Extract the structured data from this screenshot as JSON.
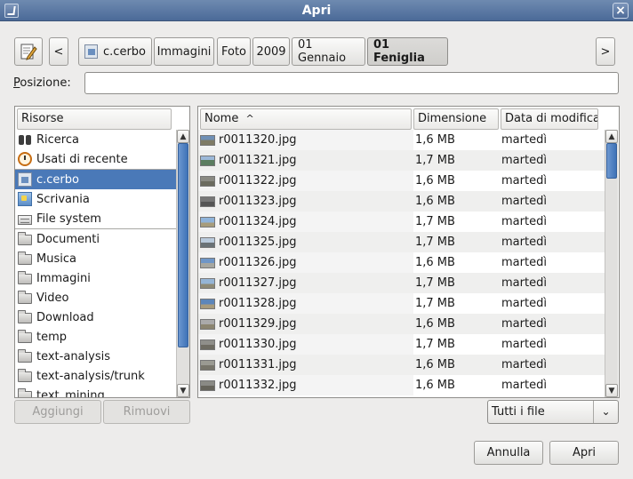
{
  "window": {
    "title": "Apri"
  },
  "breadcrumb": {
    "back": "<",
    "forward": ">",
    "items": [
      "c.cerbo",
      "Immagini",
      "Foto",
      "2009",
      "01 Gennaio",
      "01 Feniglia"
    ],
    "active_index": 5
  },
  "location": {
    "label": "Posizione:",
    "value": ""
  },
  "places": {
    "header": "Risorse",
    "items": [
      {
        "label": "Ricerca",
        "icon": "binoculars-icon"
      },
      {
        "label": "Usati di recente",
        "icon": "recent-clock-icon"
      },
      {
        "label": "c.cerbo",
        "icon": "home-folder-icon"
      },
      {
        "label": "Scrivania",
        "icon": "desktop-icon"
      },
      {
        "label": "File system",
        "icon": "drive-icon"
      }
    ],
    "selected_index": 2,
    "bookmarks": [
      "Documenti",
      "Musica",
      "Immagini",
      "Video",
      "Download",
      "temp",
      "text-analysis",
      "text-analysis/trunk",
      "text_mining"
    ],
    "add_label": "Aggiungi",
    "remove_label": "Rimuovi"
  },
  "files": {
    "columns": [
      "Nome",
      "Dimensione",
      "Data di modifica"
    ],
    "sort_indicator": "^",
    "rows": [
      {
        "name": "r0011320.jpg",
        "size": "1,6 MB",
        "date": "martedì"
      },
      {
        "name": "r0011321.jpg",
        "size": "1,7 MB",
        "date": "martedì"
      },
      {
        "name": "r0011322.jpg",
        "size": "1,6 MB",
        "date": "martedì"
      },
      {
        "name": "r0011323.jpg",
        "size": "1,6 MB",
        "date": "martedì"
      },
      {
        "name": "r0011324.jpg",
        "size": "1,7 MB",
        "date": "martedì"
      },
      {
        "name": "r0011325.jpg",
        "size": "1,7 MB",
        "date": "martedì"
      },
      {
        "name": "r0011326.jpg",
        "size": "1,6 MB",
        "date": "martedì"
      },
      {
        "name": "r0011327.jpg",
        "size": "1,7 MB",
        "date": "martedì"
      },
      {
        "name": "r0011328.jpg",
        "size": "1,7 MB",
        "date": "martedì"
      },
      {
        "name": "r0011329.jpg",
        "size": "1,6 MB",
        "date": "martedì"
      },
      {
        "name": "r0011330.jpg",
        "size": "1,7 MB",
        "date": "martedì"
      },
      {
        "name": "r0011331.jpg",
        "size": "1,6 MB",
        "date": "martedì"
      },
      {
        "name": "r0011332.jpg",
        "size": "1,6 MB",
        "date": "martedì"
      }
    ]
  },
  "filter": {
    "value": "Tutti i file",
    "arrow": "⌄"
  },
  "actions": {
    "cancel": "Annulla",
    "open": "Apri"
  },
  "colors": {
    "selection": "#4a79b8",
    "titlebar": "#5b78a4"
  }
}
